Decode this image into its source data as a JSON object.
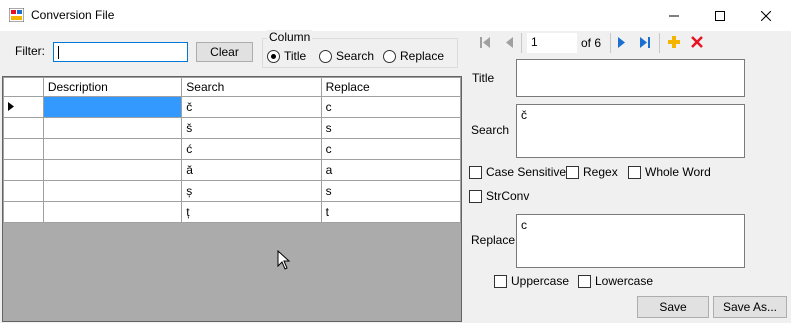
{
  "window": {
    "title": "Conversion File"
  },
  "filter": {
    "label": "Filter:",
    "value": "",
    "clear_label": "Clear"
  },
  "column_group": {
    "label": "Column",
    "options": [
      {
        "label": "Title",
        "checked": true
      },
      {
        "label": "Search",
        "checked": false
      },
      {
        "label": "Replace",
        "checked": false
      }
    ]
  },
  "grid": {
    "columns": [
      "Description",
      "Search",
      "Replace"
    ],
    "rows": [
      {
        "description": "",
        "search": "č",
        "replace": "c"
      },
      {
        "description": "",
        "search": "š",
        "replace": "s"
      },
      {
        "description": "",
        "search": "ć",
        "replace": "c"
      },
      {
        "description": "",
        "search": "ă",
        "replace": "a"
      },
      {
        "description": "",
        "search": "ș",
        "replace": "s"
      },
      {
        "description": "",
        "search": "ț",
        "replace": "t"
      }
    ]
  },
  "navigator": {
    "position": "1",
    "of_label": "of 6"
  },
  "details": {
    "title_label": "Title",
    "title_value": "",
    "search_label": "Search",
    "search_value": "č",
    "replace_label": "Replace",
    "replace_value": "c",
    "case_sensitive_label": "Case Sensitive",
    "regex_label": "Regex",
    "whole_word_label": "Whole Word",
    "strconv_label": "StrConv",
    "uppercase_label": "Uppercase",
    "lowercase_label": "Lowercase",
    "save_label": "Save",
    "save_as_label": "Save As..."
  },
  "colors": {
    "selection": "#3399ff",
    "focus_border": "#0078d7",
    "grid_background": "#ababab",
    "delete_red": "#e81123",
    "add_yellow": "#f5b400",
    "nav_blue": "#1a6fd1"
  }
}
